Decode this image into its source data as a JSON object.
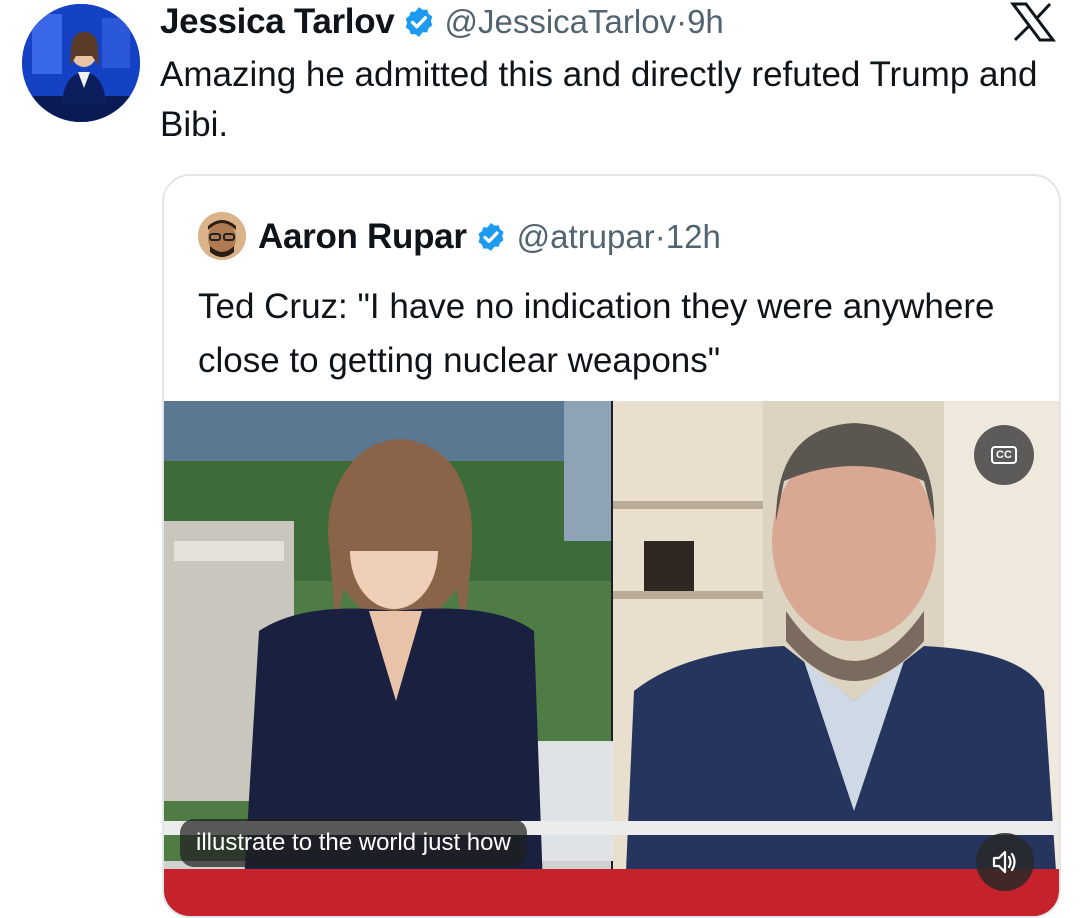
{
  "tweet": {
    "author_name": "Jessica Tarlov",
    "handle": "@JessicaTarlov",
    "separator": "·",
    "time": "9h",
    "text": "Amazing he admitted this and directly refuted Trump and Bibi."
  },
  "quoted_tweet": {
    "author_name": "Aaron Rupar",
    "handle": "@atrupar",
    "separator": "·",
    "time": "12h",
    "text": "Ted Cruz: \"I have no indication they were anywhere close to getting nuclear weapons\""
  },
  "video": {
    "caption": "illustrate to the world just how",
    "cc_label": "CC"
  },
  "icons": {
    "verified": "verified-badge-icon",
    "x_logo": "x-logo-icon",
    "mute": "speaker-icon",
    "closed_captions": "cc-icon"
  },
  "colors": {
    "verified_blue": "#1d9bf0",
    "text_primary": "#0f1419",
    "text_secondary": "#536471",
    "border": "#e3e6e8"
  }
}
